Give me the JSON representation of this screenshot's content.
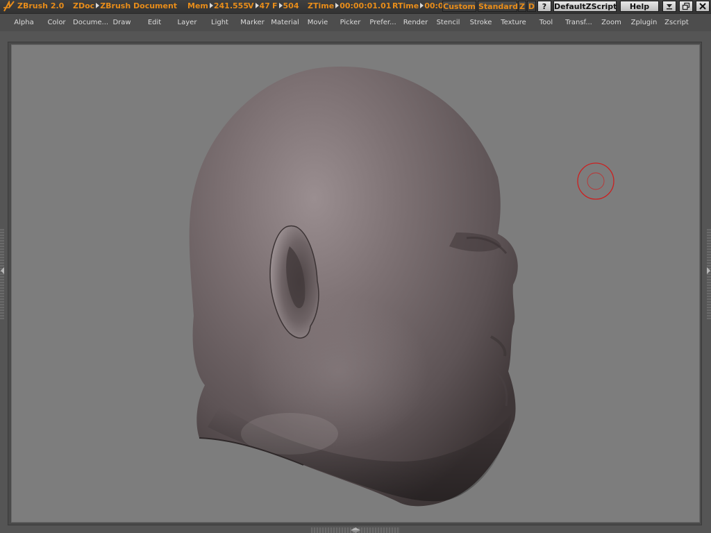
{
  "titlebar": {
    "app_name": "ZBrush 2.0",
    "zdoc_label": "ZDoc",
    "zdoc_value": "ZBrush Document",
    "mem_label": "Mem",
    "mem_value": "241.555",
    "v_label": "V",
    "v_value": "47",
    "f_label": "F",
    "f_value": "504",
    "ztime_label": "ZTime",
    "ztime_value": "00:00:01.01",
    "rtime_label": "RTime",
    "rtime_value": "00:0",
    "custom_button": "Custom",
    "standard_button": "Standard",
    "z_button": "Z",
    "d_button": "D",
    "question_button": "?",
    "script_button": "DefaultZScript",
    "help_button": "Help"
  },
  "menubar": {
    "items": [
      {
        "label": "Alpha"
      },
      {
        "label": "Color"
      },
      {
        "label": "Docume..."
      },
      {
        "label": "Draw"
      },
      {
        "label": "Edit"
      },
      {
        "label": "Layer"
      },
      {
        "label": "Light"
      },
      {
        "label": "Marker"
      },
      {
        "label": "Material"
      },
      {
        "label": "Movie"
      },
      {
        "label": "Picker"
      },
      {
        "label": "Prefer..."
      },
      {
        "label": "Render"
      },
      {
        "label": "Stencil"
      },
      {
        "label": "Stroke"
      },
      {
        "label": "Texture"
      },
      {
        "label": "Tool"
      },
      {
        "label": "Transf..."
      },
      {
        "label": "Zoom"
      },
      {
        "label": "Zplugin"
      },
      {
        "label": "Zscript"
      }
    ]
  },
  "colors": {
    "accent": "#e88d1a",
    "canvas_background": "#7d7d7d",
    "model_base": "#6e6465",
    "brush_cursor": "#cc2020"
  },
  "icons": {
    "logo": "zbrush-logo-icon",
    "minimize": "minimize-icon",
    "restore": "restore-icon",
    "close": "close-icon",
    "brush_cursor": "brush-cursor-icon"
  }
}
